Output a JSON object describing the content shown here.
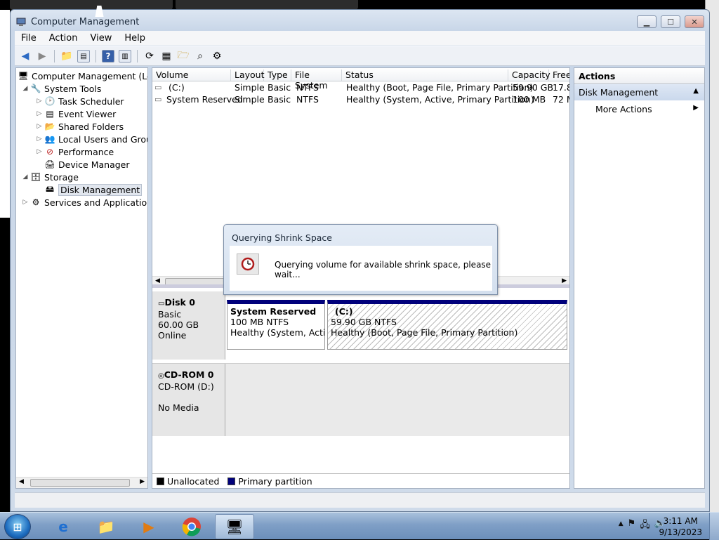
{
  "window": {
    "title": "Computer Management"
  },
  "menu": [
    "File",
    "Action",
    "View",
    "Help"
  ],
  "tree": {
    "root": "Computer Management (Local",
    "system_tools": "System Tools",
    "task_scheduler": "Task Scheduler",
    "event_viewer": "Event Viewer",
    "shared_folders": "Shared Folders",
    "local_users": "Local Users and Groups",
    "performance": "Performance",
    "device_manager": "Device Manager",
    "storage": "Storage",
    "disk_management": "Disk Management",
    "services": "Services and Applications"
  },
  "volumes": {
    "headers": [
      "Volume",
      "Layout",
      "Type",
      "File System",
      "Status",
      "Capacity",
      "Free"
    ],
    "rows": [
      [
        "(C:)",
        "Simple",
        "Basic",
        "NTFS",
        "Healthy (Boot, Page File, Primary Partition)",
        "59.90 GB",
        "17.8"
      ],
      [
        "System Reserved",
        "Simple",
        "Basic",
        "NTFS",
        "Healthy (System, Active, Primary Partition)",
        "100 MB",
        "72 M"
      ]
    ]
  },
  "disks": {
    "disk0": {
      "name": "Disk 0",
      "type": "Basic",
      "size": "60.00 GB",
      "status": "Online"
    },
    "sysres": {
      "name": "System Reserved",
      "size": "100 MB NTFS",
      "status": "Healthy (System, Active,"
    },
    "cpart": {
      "name": "(C:)",
      "size": "59.90 GB NTFS",
      "status": "Healthy (Boot, Page File, Primary Partition)"
    },
    "cdrom": {
      "name": "CD-ROM 0",
      "type": "CD-ROM (D:)",
      "status": "No Media"
    }
  },
  "legend": {
    "unallocated": "Unallocated",
    "primary": "Primary partition",
    "unallocated_color": "#000000",
    "primary_color": "#00007b"
  },
  "actions": {
    "header": "Actions",
    "section": "Disk Management",
    "more": "More Actions"
  },
  "dialog": {
    "title": "Querying Shrink Space",
    "message": "Querying volume for available shrink space, please wait..."
  },
  "taskbar": {
    "time": "3:11 AM",
    "date": "9/13/2023"
  },
  "colors": {
    "accent": "#00007b",
    "taskbar": "#7f9fc6"
  }
}
